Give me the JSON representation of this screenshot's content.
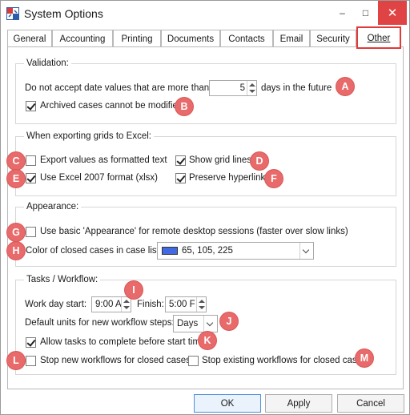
{
  "window": {
    "title": "System Options",
    "controls": {
      "minimize": "–",
      "maximize": "□",
      "close": "✕"
    }
  },
  "tabs": [
    {
      "label": "General"
    },
    {
      "label": "Accounting"
    },
    {
      "label": "Printing"
    },
    {
      "label": "Documents"
    },
    {
      "label": "Contacts"
    },
    {
      "label": "Email"
    },
    {
      "label": "Security"
    },
    {
      "label": "Other",
      "active": true
    }
  ],
  "validation": {
    "title": "Validation:",
    "date_prefix": "Do not accept date values that are more than:",
    "date_value": "5",
    "date_suffix": "days in the future",
    "archived_label": "Archived cases cannot be modified",
    "archived_checked": true
  },
  "export": {
    "title": "When exporting grids to Excel:",
    "formatted_text_label": "Export values as formatted text",
    "formatted_text_checked": false,
    "show_grid_label": "Show grid lines",
    "show_grid_checked": true,
    "xlsx_label": "Use Excel 2007 format (xlsx)",
    "xlsx_checked": true,
    "hyperlinks_label": "Preserve hyperlinks",
    "hyperlinks_checked": true
  },
  "appearance": {
    "title": "Appearance:",
    "basic_label": "Use basic 'Appearance' for remote desktop sessions (faster over slow links)",
    "basic_checked": false,
    "color_label": "Color of closed cases in case list:",
    "color_value": "65, 105, 225",
    "color_hex": "#4169e1"
  },
  "workflow": {
    "title": "Tasks / Workflow:",
    "start_label": "Work day start:",
    "start_value": "9:00 A",
    "finish_label": "Finish:",
    "finish_value": "5:00 F",
    "units_label": "Default units for new workflow steps:",
    "units_value": "Days",
    "allow_label": "Allow tasks to complete before start time",
    "allow_checked": true,
    "stop_new_label": "Stop new workflows for closed cases",
    "stop_new_checked": false,
    "stop_existing_label": "Stop existing workflows for closed cases",
    "stop_existing_checked": false
  },
  "markers": [
    "A",
    "B",
    "C",
    "D",
    "E",
    "F",
    "G",
    "H",
    "I",
    "J",
    "K",
    "L",
    "M"
  ],
  "buttons": {
    "ok": "OK",
    "apply": "Apply",
    "cancel": "Cancel"
  },
  "colors": {
    "accent_red": "#e03a3a",
    "marker": "#e86a6a"
  }
}
